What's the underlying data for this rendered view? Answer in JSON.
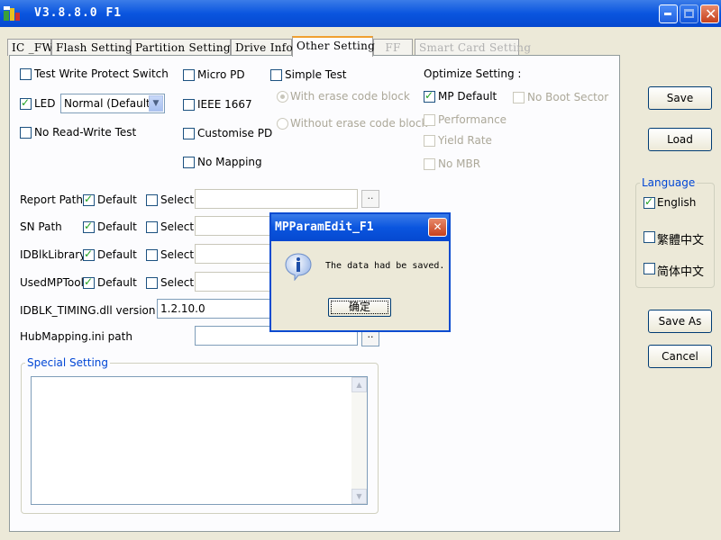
{
  "window": {
    "title": "V3.8.8.0 F1"
  },
  "tabs": [
    {
      "label": "IC _FW"
    },
    {
      "label": "Flash Setting"
    },
    {
      "label": "Partition Setting"
    },
    {
      "label": "Drive Info"
    },
    {
      "label": "Other Setting"
    },
    {
      "label": "FF"
    },
    {
      "label": "Smart Card Setting"
    }
  ],
  "options": {
    "test_write_protect": "Test Write Protect Switch",
    "led": "LED",
    "led_mode": "Normal (Default)",
    "no_read_write": "No Read-Write Test",
    "micro_pd": "Micro PD",
    "ieee1667": "IEEE 1667",
    "customise_pd": "Customise PD",
    "no_mapping": "No Mapping",
    "simple_test": "Simple Test",
    "with_erase": "With erase code block",
    "without_erase": "Without erase code block"
  },
  "optimize": {
    "title": "Optimize Setting :",
    "mp_default": "MP Default",
    "no_boot_sector": "No Boot Sector",
    "performance": "Performance",
    "yield_rate": "Yield Rate",
    "no_mbr": "No MBR"
  },
  "paths": {
    "report_path": "Report Path :",
    "sn_path": "SN Path",
    "idblk_library": "IDBlkLibrary:",
    "used_mptool": "UsedMPTool:",
    "default": "Default",
    "select": "Select",
    "browse": "..",
    "idblk_timing": "IDBLK_TIMING.dll version :",
    "idblk_timing_value": "1.2.10.0",
    "hubmapping": "HubMapping.ini path"
  },
  "special_setting": "Special Setting",
  "buttons": {
    "save": "Save",
    "load": "Load",
    "save_as": "Save As",
    "cancel": "Cancel"
  },
  "language": {
    "title": "Language",
    "english": "English",
    "trad_chinese": "繁體中文",
    "simp_chinese": "简体中文"
  },
  "dialog": {
    "title": "MPParamEdit_F1",
    "message": "The data had be saved.",
    "ok": "确定"
  }
}
